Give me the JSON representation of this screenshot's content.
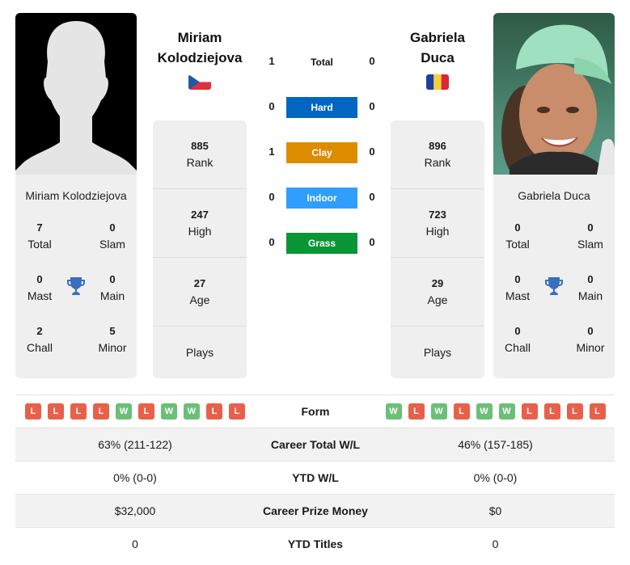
{
  "colors": {
    "hard": "#0066c2",
    "clay": "#dd8c00",
    "indoor": "#2f9eff",
    "grass": "#0a9636",
    "win": "#6cbf78",
    "loss": "#e8604a",
    "trophy": "#3a6ebf"
  },
  "players": {
    "left": {
      "name_line1": "Miriam",
      "name_line2": "Kolodziejova",
      "full_name": "Miriam Kolodziejova",
      "flag": "czech-republic",
      "photo": "silhouette-placeholder",
      "titles": {
        "total": {
          "value": "7",
          "label": "Total"
        },
        "slam": {
          "value": "0",
          "label": "Slam"
        },
        "mast": {
          "value": "0",
          "label": "Mast"
        },
        "main": {
          "value": "0",
          "label": "Main"
        },
        "chall": {
          "value": "2",
          "label": "Chall"
        },
        "minor": {
          "value": "5",
          "label": "Minor"
        }
      },
      "stats": {
        "rank": {
          "value": "885",
          "label": "Rank"
        },
        "high": {
          "value": "247",
          "label": "High"
        },
        "age": {
          "value": "27",
          "label": "Age"
        },
        "plays": {
          "value": "",
          "label": "Plays"
        }
      },
      "form": [
        "L",
        "L",
        "L",
        "L",
        "W",
        "L",
        "W",
        "W",
        "L",
        "L"
      ]
    },
    "right": {
      "name_line1": "Gabriela",
      "name_line2": "Duca",
      "full_name": "Gabriela Duca",
      "flag": "romania",
      "photo": "player-portrait",
      "titles": {
        "total": {
          "value": "0",
          "label": "Total"
        },
        "slam": {
          "value": "0",
          "label": "Slam"
        },
        "mast": {
          "value": "0",
          "label": "Mast"
        },
        "main": {
          "value": "0",
          "label": "Main"
        },
        "chall": {
          "value": "0",
          "label": "Chall"
        },
        "minor": {
          "value": "0",
          "label": "Minor"
        }
      },
      "stats": {
        "rank": {
          "value": "896",
          "label": "Rank"
        },
        "high": {
          "value": "723",
          "label": "High"
        },
        "age": {
          "value": "29",
          "label": "Age"
        },
        "plays": {
          "value": "",
          "label": "Plays"
        }
      },
      "form": [
        "W",
        "L",
        "W",
        "L",
        "W",
        "W",
        "L",
        "L",
        "L",
        "L"
      ]
    }
  },
  "h2h": [
    {
      "label": "Total",
      "left": "1",
      "right": "0",
      "surface": "total"
    },
    {
      "label": "Hard",
      "left": "0",
      "right": "0",
      "surface": "hard"
    },
    {
      "label": "Clay",
      "left": "1",
      "right": "0",
      "surface": "clay"
    },
    {
      "label": "Indoor",
      "left": "0",
      "right": "0",
      "surface": "indoor"
    },
    {
      "label": "Grass",
      "left": "0",
      "right": "0",
      "surface": "grass"
    }
  ],
  "table": {
    "form_label": "Form",
    "rows": [
      {
        "label": "Career Total W/L",
        "left": "63% (211-122)",
        "right": "46% (157-185)"
      },
      {
        "label": "YTD W/L",
        "left": "0% (0-0)",
        "right": "0% (0-0)"
      },
      {
        "label": "Career Prize Money",
        "left": "$32,000",
        "right": "$0"
      },
      {
        "label": "YTD Titles",
        "left": "0",
        "right": "0"
      }
    ]
  }
}
